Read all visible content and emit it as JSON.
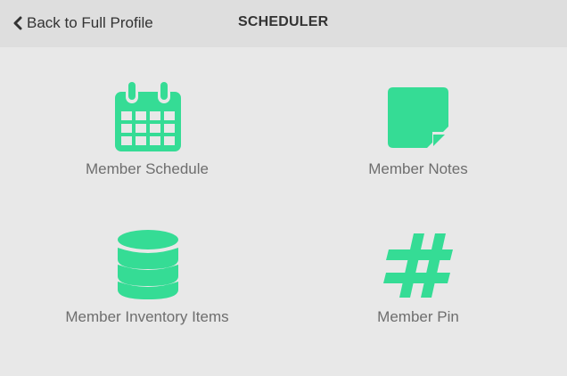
{
  "header": {
    "back_label": "Back to Full Profile",
    "title": "SCHEDULER"
  },
  "tiles": [
    {
      "label": "Member Schedule",
      "icon": "calendar-icon"
    },
    {
      "label": "Member Notes",
      "icon": "sticky-note-icon"
    },
    {
      "label": "Member Inventory Items",
      "icon": "database-icon"
    },
    {
      "label": "Member Pin",
      "icon": "hashtag-icon"
    }
  ],
  "colors": {
    "accent": "#35dc95",
    "background": "#e8e8e8",
    "header_background": "#dedede",
    "title_text": "#333333",
    "label_text": "#6e6e6e"
  }
}
